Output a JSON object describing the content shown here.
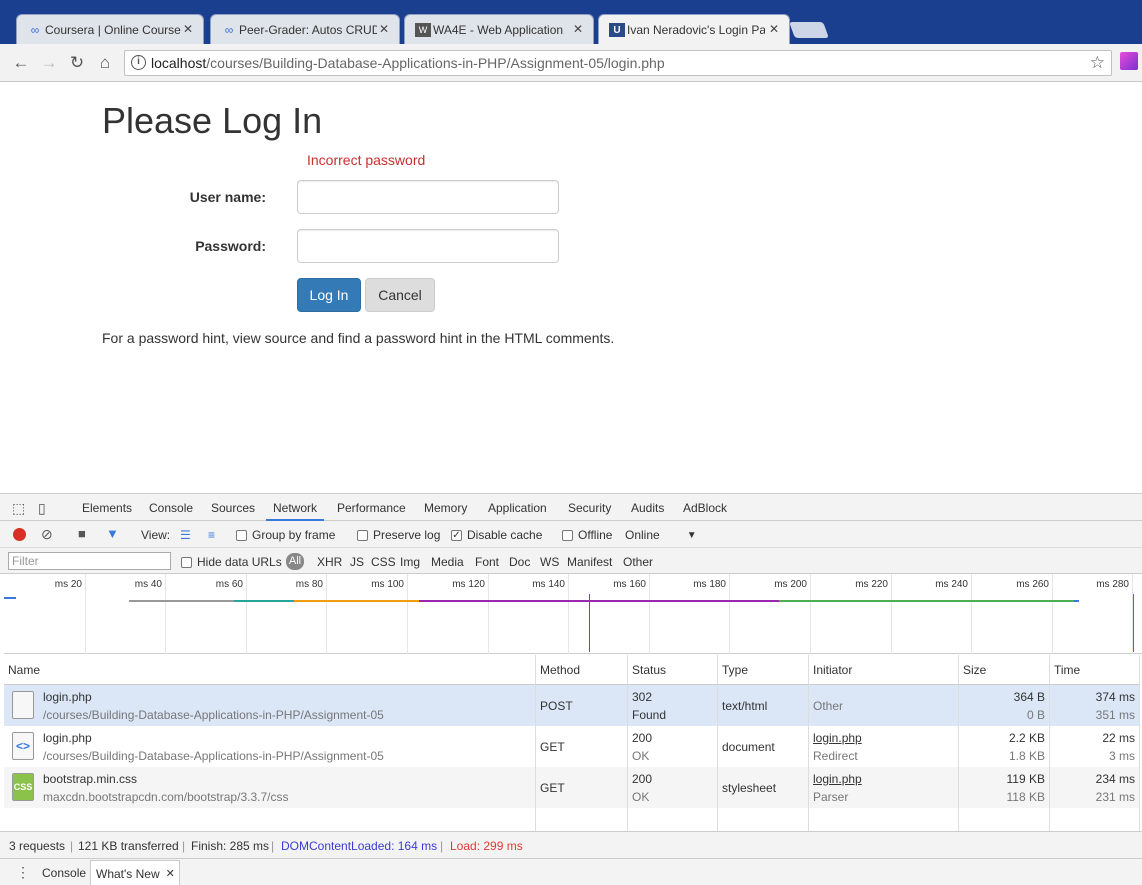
{
  "browser": {
    "tabs": [
      {
        "title": "Coursera | Online Course",
        "favicon": "coursera-icon"
      },
      {
        "title": "Peer-Grader: Autos CRUD",
        "favicon": "coursera-icon"
      },
      {
        "title": "WA4E - Web Application",
        "favicon": "wa4e-icon"
      },
      {
        "title": "Ivan Neradovic's Login Page",
        "favicon": "u-icon"
      }
    ],
    "address": {
      "host": "localhost",
      "path": "/courses/Building-Database-Applications-in-PHP/Assignment-05/login.php"
    }
  },
  "page": {
    "heading": "Please Log In",
    "error": "Incorrect password",
    "username_label": "User name:",
    "password_label": "Password:",
    "login_button": "Log In",
    "cancel_button": "Cancel",
    "hint": "For a password hint, view source and find a password hint in the HTML comments."
  },
  "devtools": {
    "tabs": [
      "Elements",
      "Console",
      "Sources",
      "Network",
      "Performance",
      "Memory",
      "Application",
      "Security",
      "Audits",
      "AdBlock"
    ],
    "active_tab": "Network",
    "toolbar": {
      "view_label": "View:",
      "group_by_frame": "Group by frame",
      "preserve_log": "Preserve log",
      "disable_cache": "Disable cache",
      "offline": "Offline",
      "throttle": "Online"
    },
    "filter": {
      "placeholder": "Filter",
      "hide_data_urls": "Hide data URLs",
      "types": [
        "All",
        "XHR",
        "JS",
        "CSS",
        "Img",
        "Media",
        "Font",
        "Doc",
        "WS",
        "Manifest",
        "Other"
      ]
    },
    "timeline_ticks": [
      "20 ms",
      "40 ms",
      "60 ms",
      "80 ms",
      "100 ms",
      "120 ms",
      "140 ms",
      "160 ms",
      "180 ms",
      "200 ms",
      "220 ms",
      "240 ms",
      "260 ms",
      "280 ms"
    ],
    "columns": [
      "Name",
      "Method",
      "Status",
      "Type",
      "Initiator",
      "Size",
      "Time"
    ],
    "requests": [
      {
        "name": "login.php",
        "path": "/courses/Building-Database-Applications-in-PHP/Assignment-05",
        "method": "POST",
        "status": "302",
        "status_text": "Found",
        "type": "text/html",
        "initiator": "Other",
        "initiator_detail": "",
        "size": "364 B",
        "size2": "0 B",
        "time": "374 ms",
        "time2": "351 ms",
        "icon": "blank-document-icon"
      },
      {
        "name": "login.php",
        "path": "/courses/Building-Database-Applications-in-PHP/Assignment-05",
        "method": "GET",
        "status": "200",
        "status_text": "OK",
        "type": "document",
        "initiator": "login.php",
        "initiator_detail": "Redirect",
        "size": "2.2 KB",
        "size2": "1.8 KB",
        "time": "22 ms",
        "time2": "3 ms",
        "icon": "html-document-icon"
      },
      {
        "name": "bootstrap.min.css",
        "path": "maxcdn.bootstrapcdn.com/bootstrap/3.3.7/css",
        "method": "GET",
        "status": "200",
        "status_text": "OK",
        "type": "stylesheet",
        "initiator": "login.php",
        "initiator_detail": "Parser",
        "size": "119 KB",
        "size2": "118 KB",
        "time": "234 ms",
        "time2": "231 ms",
        "icon": "css-document-icon"
      }
    ],
    "summary": {
      "requests": "3 requests",
      "transferred": "121 KB transferred",
      "finish": "Finish: 285 ms",
      "dcl": "DOMContentLoaded: 164 ms",
      "load": "Load: 299 ms"
    },
    "drawer_tabs": [
      "Console",
      "What's New"
    ]
  }
}
